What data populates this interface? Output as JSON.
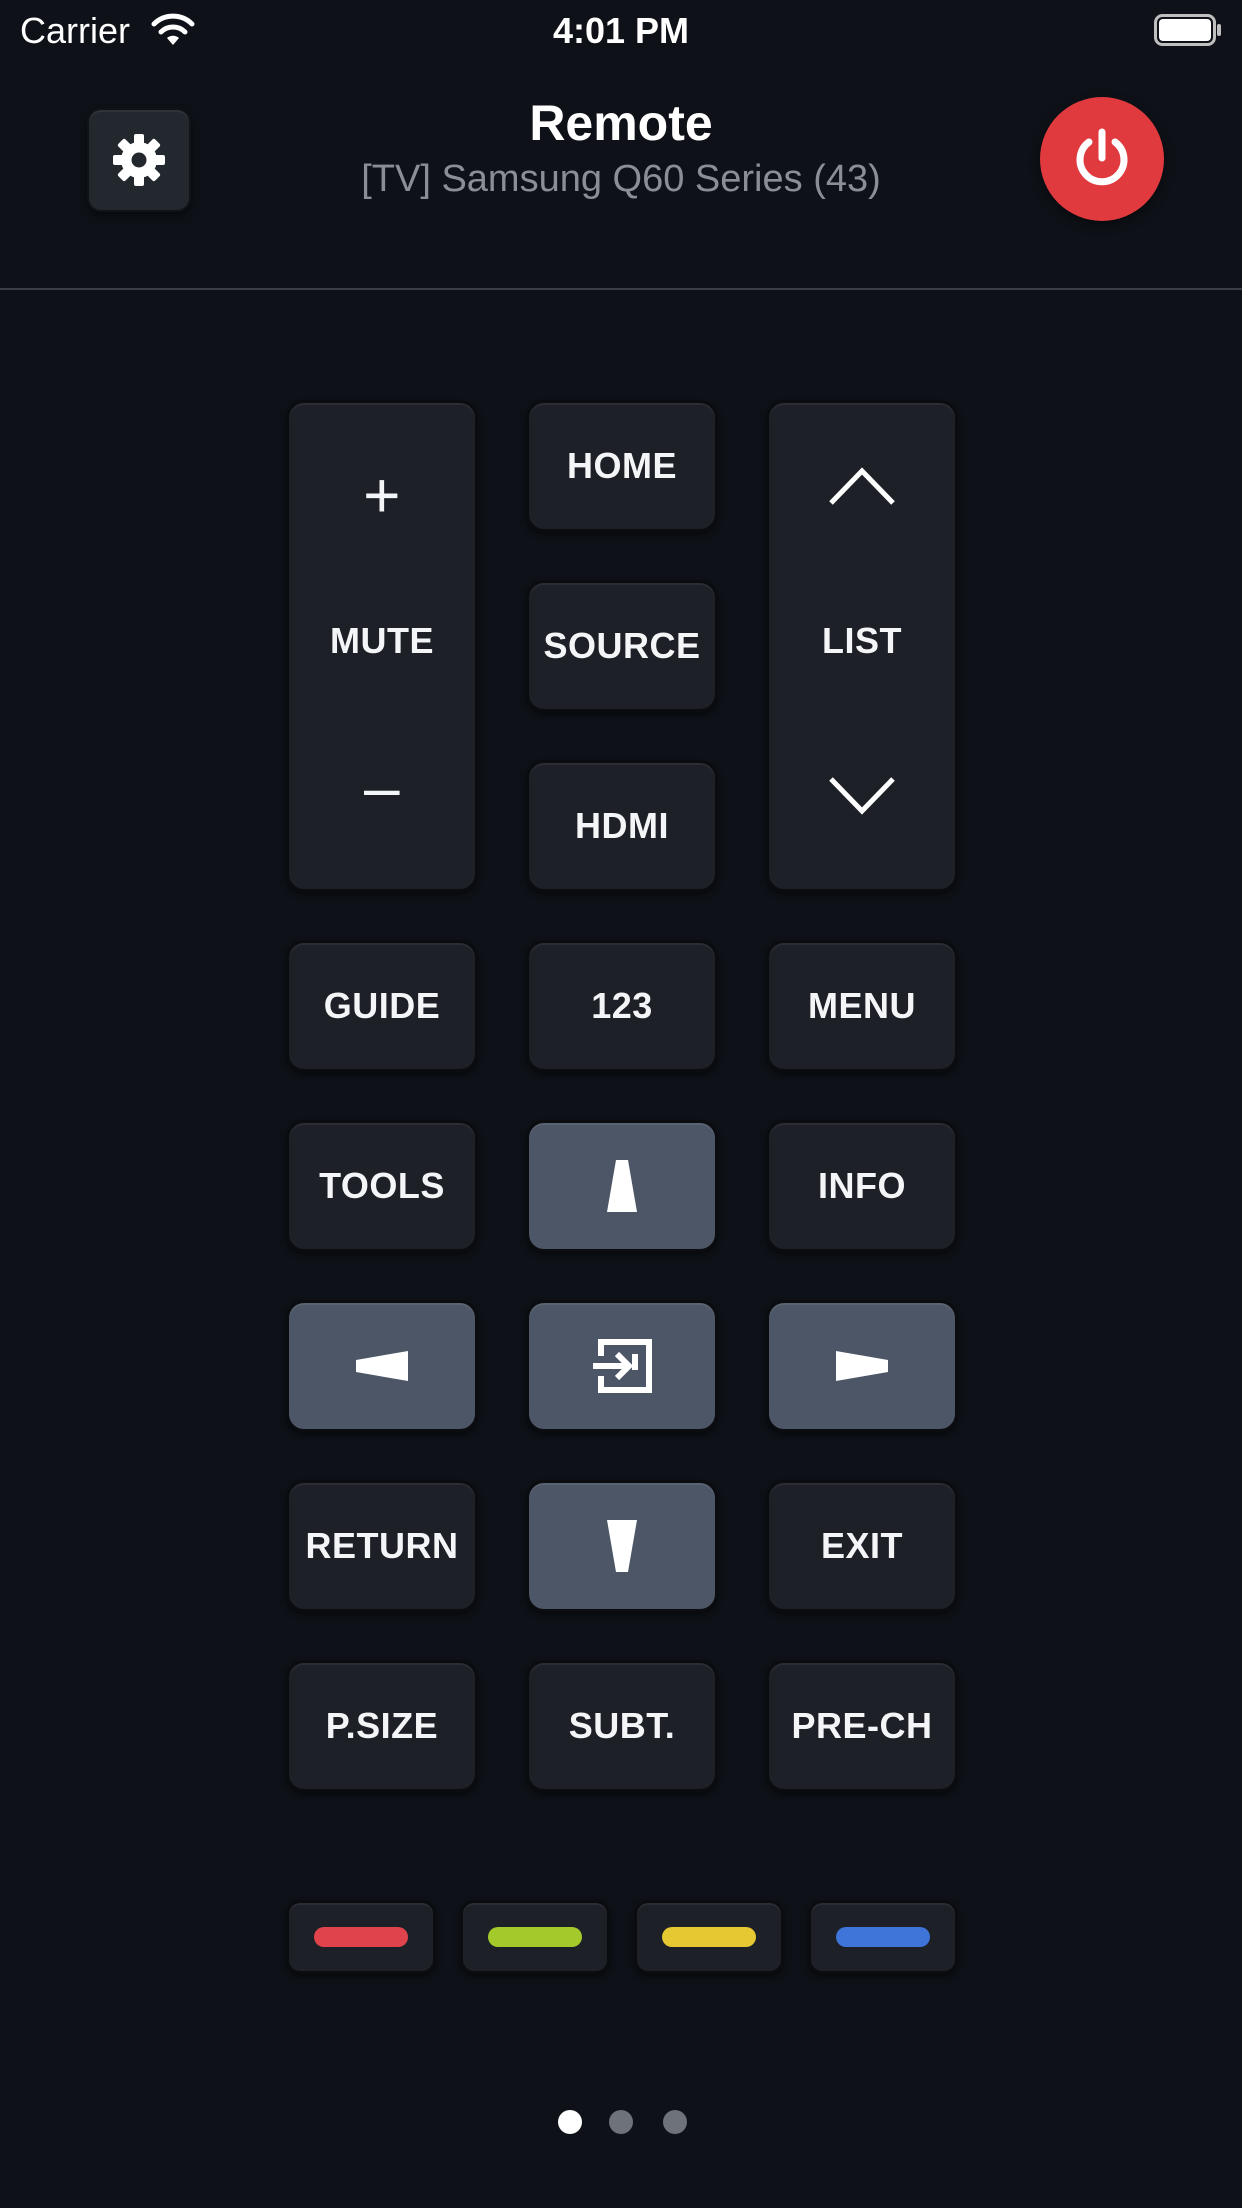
{
  "status_bar": {
    "carrier": "Carrier",
    "time": "4:01 PM"
  },
  "header": {
    "title": "Remote",
    "subtitle": "[TV] Samsung Q60 Series (43)",
    "settings_icon": "gear-icon",
    "power_icon": "power-icon",
    "power_color": "#e03a3e"
  },
  "remote": {
    "volume": {
      "up": "+",
      "label": "MUTE",
      "down": "–"
    },
    "home": "HOME",
    "source": "SOURCE",
    "hdmi": "HDMI",
    "channel": {
      "label": "LIST",
      "up_icon": "chevron-up-icon",
      "down_icon": "chevron-down-icon"
    },
    "guide": "GUIDE",
    "numbers": "123",
    "menu": "MENU",
    "tools": "TOOLS",
    "info": "INFO",
    "return": "RETURN",
    "exit": "EXIT",
    "psize": "P.SIZE",
    "subt": "SUBT.",
    "prech": "PRE-CH",
    "dpad": {
      "up": "arrow-up-icon",
      "left": "arrow-left-icon",
      "ok": "enter-icon",
      "right": "arrow-right-icon",
      "down": "arrow-down-icon"
    }
  },
  "color_keys": [
    {
      "name": "red",
      "color": "#e0434b"
    },
    {
      "name": "green",
      "color": "#a4c92b"
    },
    {
      "name": "yellow",
      "color": "#e6c832"
    },
    {
      "name": "blue",
      "color": "#3f74d9"
    }
  ],
  "pagination": {
    "pages": 3,
    "current": 1
  }
}
